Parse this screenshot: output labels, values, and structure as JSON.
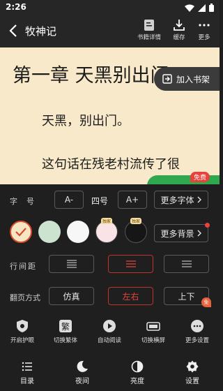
{
  "status": {
    "time": "2:26"
  },
  "header": {
    "title": "牧神记",
    "tools": [
      {
        "label": "书籍详情",
        "icon": "book-detail-icon"
      },
      {
        "label": "缓存",
        "icon": "download-icon"
      },
      {
        "label": "更多",
        "icon": "more-dots-icon"
      }
    ]
  },
  "reader": {
    "chapter_title": "第一章 天黑别出门",
    "paragraphs": [
      "天黑，别出门。",
      "这句话在残老村流传了很"
    ],
    "add_shelf": "加入书架",
    "free_badge": "免费"
  },
  "settings": {
    "font": {
      "label": "字　号",
      "decrease": "A-",
      "size": "四号",
      "increase": "A+",
      "more": "更多字体"
    },
    "background": {
      "swatches": [
        {
          "name": "cream",
          "color": "#f6e6c4",
          "selected": true
        },
        {
          "name": "green",
          "color": "#cce3cf"
        },
        {
          "name": "white",
          "color": "#f7f7f7"
        },
        {
          "name": "pink",
          "color": "#f9e3e6",
          "badge": "独家"
        },
        {
          "name": "dark",
          "color": "#161616",
          "badge": "独家"
        }
      ],
      "more": "更多背景"
    },
    "line_spacing": {
      "label": "行间距",
      "options": [
        "宽",
        "中",
        "窄"
      ],
      "selected": 1
    },
    "page_turn": {
      "label": "翻页方式",
      "options": [
        "仿真",
        "左右",
        "上下"
      ],
      "selected": 1,
      "corner_tag": "免"
    }
  },
  "quick_actions": [
    {
      "label": "开启护眼",
      "icon": "eye-protect-icon"
    },
    {
      "label": "切换繁体",
      "icon": "traditional-chinese-icon",
      "glyph": "繁"
    },
    {
      "label": "自动阅读",
      "icon": "play-icon"
    },
    {
      "label": "切换横屏",
      "icon": "rotate-screen-icon"
    },
    {
      "label": "更多设置",
      "icon": "more-settings-icon"
    }
  ],
  "nav": [
    {
      "label": "目录",
      "icon": "list-icon"
    },
    {
      "label": "夜间",
      "icon": "moon-icon"
    },
    {
      "label": "亮度",
      "icon": "brightness-icon"
    },
    {
      "label": "设置",
      "icon": "gear-icon"
    }
  ],
  "colors": {
    "accent_red": "#e2453b",
    "reader_bg": "#f7e9c9",
    "panel_bg": "#1f1f1f",
    "free_green": "#2fa84f"
  }
}
